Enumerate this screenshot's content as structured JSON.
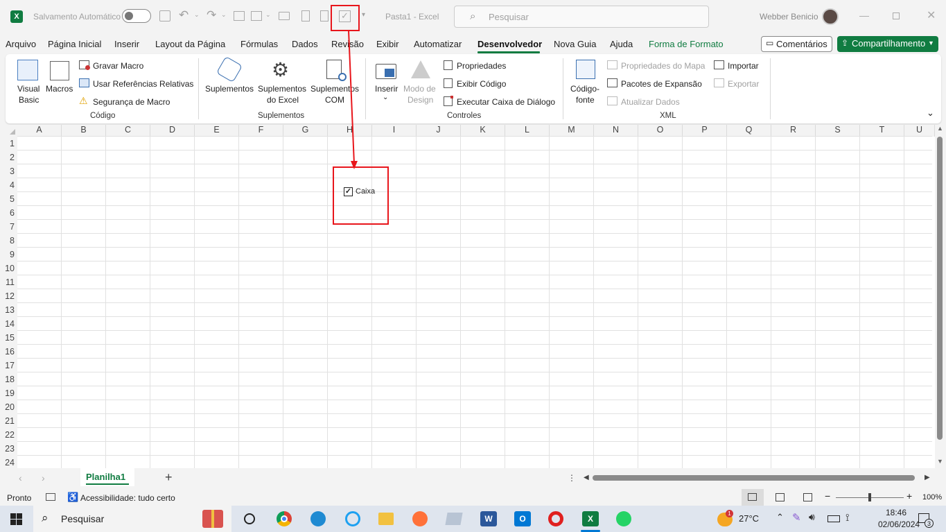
{
  "titlebar": {
    "autosave_label": "Salvamento Automático",
    "doc_title": "Pasta1  -  Excel",
    "search_placeholder": "Pesquisar",
    "user_name": "Webber Benicio"
  },
  "menu": {
    "items": [
      "Arquivo",
      "Página Inicial",
      "Inserir",
      "Layout da Página",
      "Fórmulas",
      "Dados",
      "Revisão",
      "Exibir",
      "Automatizar",
      "Desenvolvedor",
      "Nova Guia",
      "Ajuda",
      "Forma de Formato"
    ],
    "comments_label": "Comentários",
    "share_label": "Compartilhamento"
  },
  "ribbon": {
    "codigo": {
      "visual_basic_1": "Visual",
      "visual_basic_2": "Basic",
      "macros": "Macros",
      "gravar_macro": "Gravar Macro",
      "usar_ref": "Usar Referências Relativas",
      "seguranca": "Segurança de Macro",
      "group": "Código"
    },
    "suplementos": {
      "suplementos": "Suplementos",
      "excel_1": "Suplementos",
      "excel_2": "do Excel",
      "com_1": "Suplementos",
      "com_2": "COM",
      "group": "Suplementos"
    },
    "controles": {
      "inserir": "Inserir",
      "modo_1": "Modo de",
      "modo_2": "Design",
      "propriedades": "Propriedades",
      "exibir_codigo": "Exibir Código",
      "executar": "Executar Caixa de Diálogo",
      "group": "Controles"
    },
    "xml": {
      "codigo_1": "Código-",
      "codigo_2": "fonte",
      "prop_mapa": "Propriedades do Mapa",
      "pacotes": "Pacotes de Expansão",
      "atualizar": "Atualizar Dados",
      "importar": "Importar",
      "exportar": "Exportar",
      "group": "XML"
    }
  },
  "grid": {
    "columns": [
      "A",
      "B",
      "C",
      "D",
      "E",
      "F",
      "G",
      "H",
      "I",
      "J",
      "K",
      "L",
      "M",
      "N",
      "O",
      "P",
      "Q",
      "R",
      "S",
      "T",
      "U"
    ],
    "rows": [
      "1",
      "2",
      "3",
      "4",
      "5",
      "6",
      "7",
      "8",
      "9",
      "10",
      "11",
      "12",
      "13",
      "14",
      "15",
      "16",
      "17",
      "18",
      "19",
      "20",
      "21",
      "22",
      "23",
      "24"
    ],
    "checkbox_label": "Caixa",
    "checkbox_checked": true
  },
  "sheets": {
    "active": "Planilha1"
  },
  "status": {
    "ready": "Pronto",
    "accessibility": "Acessibilidade: tudo certo",
    "zoom": "100%"
  },
  "taskbar": {
    "search_label": "Pesquisar",
    "temperature": "27°C",
    "time": "18:46",
    "date": "02/06/2024",
    "weather_badge": "1",
    "notifications": "3"
  },
  "colors": {
    "excel_green": "#107c41",
    "highlight_red": "#e8151b"
  }
}
